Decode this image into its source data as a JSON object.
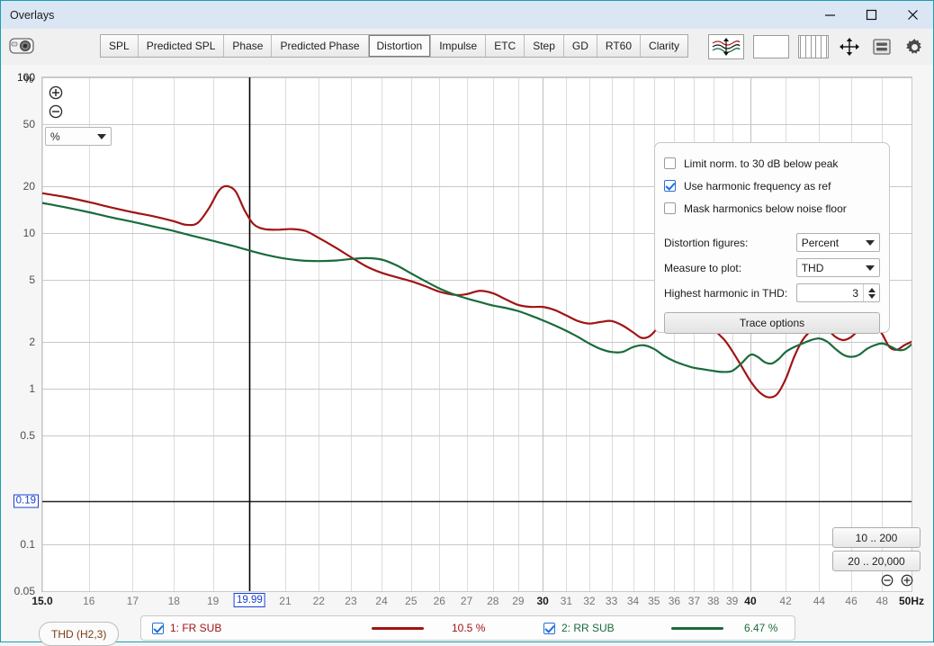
{
  "window": {
    "title": "Overlays",
    "controls": [
      {
        "name": "minimize-button",
        "glyph": "minimize"
      },
      {
        "name": "maximize-button",
        "glyph": "maximize"
      },
      {
        "name": "close-button",
        "glyph": "close"
      }
    ]
  },
  "toolbar": {
    "camera_icon": "camera-icon",
    "tabs": [
      {
        "label": "SPL",
        "active": false
      },
      {
        "label": "Predicted SPL",
        "active": false
      },
      {
        "label": "Phase",
        "active": false
      },
      {
        "label": "Predicted Phase",
        "active": false
      },
      {
        "label": "Distortion",
        "active": true
      },
      {
        "label": "Impulse",
        "active": false
      },
      {
        "label": "ETC",
        "active": false
      },
      {
        "label": "Step",
        "active": false
      },
      {
        "label": "GD",
        "active": false
      },
      {
        "label": "RT60",
        "active": false
      },
      {
        "label": "Clarity",
        "active": false
      }
    ],
    "right_icons": [
      {
        "name": "waveform-overlay-icon"
      },
      {
        "name": "blank-panel-icon"
      },
      {
        "name": "vertical-bars-icon"
      },
      {
        "name": "fit-to-window-icon"
      },
      {
        "name": "legend-toggle-icon"
      },
      {
        "name": "gear-icon"
      }
    ]
  },
  "graph_controls": {
    "zoom_in_icon": "zoom-in-icon",
    "zoom_out_icon": "zoom-out-icon",
    "unit_select_value": "%",
    "trace_pill_label": "THD (H2,3)",
    "range_buttons": [
      "10 .. 200",
      "20 .. 20,000"
    ],
    "range_zoom_out_icon": "zoom-out-icon",
    "range_zoom_in_icon": "zoom-in-icon"
  },
  "options_panel": {
    "checkboxes": [
      {
        "label": "Limit norm. to 30 dB below peak",
        "checked": false
      },
      {
        "label": "Use harmonic frequency as ref",
        "checked": true
      },
      {
        "label": "Mask harmonics below noise floor",
        "checked": false
      }
    ],
    "fields": [
      {
        "label": "Distortion figures:",
        "value": "Percent",
        "type": "combo"
      },
      {
        "label": "Measure to plot:",
        "value": "THD",
        "type": "combo"
      },
      {
        "label": "Highest harmonic in THD:",
        "value": "3",
        "type": "spinner"
      }
    ],
    "trace_options_button": "Trace options"
  },
  "legend": {
    "items": [
      {
        "label": "1: FR SUB",
        "value": "10.5 %",
        "color": "#a01414",
        "checked": true
      },
      {
        "label": "2: RR SUB",
        "value": "6.47 %",
        "color": "#1a6b3c",
        "checked": true
      }
    ]
  },
  "chart_data": {
    "type": "line",
    "title": "Distortion",
    "xlabel": "Hz",
    "ylabel": "%",
    "xscale": "log",
    "yscale": "log",
    "xlim": [
      15.0,
      50.0
    ],
    "ylim": [
      0.05,
      100
    ],
    "grid": true,
    "unit_suffix": "Hz",
    "xticks": [
      "15.0",
      "16",
      "17",
      "18",
      "19",
      "21",
      "22",
      "23",
      "24",
      "25",
      "26",
      "27",
      "28",
      "29",
      "30",
      "31",
      "32",
      "33",
      "34",
      "35",
      "36",
      "37",
      "38",
      "39",
      "40",
      "42",
      "44",
      "46",
      "48",
      "50Hz"
    ],
    "xtick_values": [
      15.0,
      16,
      17,
      18,
      19,
      21,
      22,
      23,
      24,
      25,
      26,
      27,
      28,
      29,
      30,
      31,
      32,
      33,
      34,
      35,
      36,
      37,
      38,
      39,
      40,
      42,
      44,
      46,
      48,
      50
    ],
    "xticks_bold": [
      "15.0",
      "30",
      "40",
      "50Hz"
    ],
    "yticks": [
      "100",
      "50",
      "20",
      "10",
      "5",
      "2",
      "1",
      "0.5",
      "0.1",
      "0.05"
    ],
    "ytick_values": [
      100,
      50,
      20,
      10,
      5,
      2,
      1,
      0.5,
      0.1,
      0.05
    ],
    "cursor": {
      "x_label": "19.99",
      "x_value": 19.99,
      "y_label": "0.19",
      "y_value": 0.19
    },
    "series": [
      {
        "name": "1: FR SUB",
        "color": "#a01414",
        "readout": "10.5 %",
        "points": [
          [
            15.0,
            18.0
          ],
          [
            15.5,
            17.0
          ],
          [
            16.0,
            15.8
          ],
          [
            16.5,
            14.6
          ],
          [
            17.0,
            13.6
          ],
          [
            17.5,
            12.8
          ],
          [
            18.0,
            11.9
          ],
          [
            18.3,
            11.3
          ],
          [
            18.6,
            11.6
          ],
          [
            18.9,
            14.5
          ],
          [
            19.15,
            18.6
          ],
          [
            19.35,
            20.0
          ],
          [
            19.6,
            18.6
          ],
          [
            19.85,
            14.0
          ],
          [
            20.1,
            11.4
          ],
          [
            20.4,
            10.6
          ],
          [
            20.8,
            10.5
          ],
          [
            21.2,
            10.6
          ],
          [
            21.6,
            10.3
          ],
          [
            22.0,
            9.3
          ],
          [
            22.5,
            8.1
          ],
          [
            23.0,
            7.0
          ],
          [
            23.5,
            6.1
          ],
          [
            24.0,
            5.55
          ],
          [
            24.5,
            5.2
          ],
          [
            25.0,
            4.9
          ],
          [
            25.5,
            4.55
          ],
          [
            26.0,
            4.2
          ],
          [
            26.6,
            4.0
          ],
          [
            27.0,
            4.05
          ],
          [
            27.5,
            4.25
          ],
          [
            28.0,
            4.1
          ],
          [
            28.5,
            3.75
          ],
          [
            29.0,
            3.45
          ],
          [
            29.5,
            3.35
          ],
          [
            30.0,
            3.35
          ],
          [
            30.5,
            3.2
          ],
          [
            31.0,
            2.95
          ],
          [
            31.5,
            2.72
          ],
          [
            32.0,
            2.62
          ],
          [
            32.5,
            2.68
          ],
          [
            33.0,
            2.72
          ],
          [
            33.5,
            2.55
          ],
          [
            34.0,
            2.3
          ],
          [
            34.4,
            2.12
          ],
          [
            34.8,
            2.18
          ],
          [
            35.2,
            2.5
          ],
          [
            35.6,
            3.1
          ],
          [
            36.0,
            3.6
          ],
          [
            36.4,
            3.85
          ],
          [
            36.8,
            3.8
          ],
          [
            37.3,
            3.35
          ],
          [
            37.8,
            2.75
          ],
          [
            38.2,
            2.3
          ],
          [
            38.6,
            2.05
          ],
          [
            39.0,
            1.75
          ],
          [
            39.5,
            1.4
          ],
          [
            40.0,
            1.12
          ],
          [
            40.5,
            0.95
          ],
          [
            41.0,
            0.88
          ],
          [
            41.5,
            0.92
          ],
          [
            42.0,
            1.15
          ],
          [
            42.5,
            1.6
          ],
          [
            43.0,
            2.05
          ],
          [
            43.5,
            2.35
          ],
          [
            44.0,
            2.5
          ],
          [
            44.5,
            2.4
          ],
          [
            45.0,
            2.15
          ],
          [
            45.5,
            2.05
          ],
          [
            46.0,
            2.15
          ],
          [
            46.5,
            2.4
          ],
          [
            47.0,
            2.6
          ],
          [
            47.5,
            2.6
          ],
          [
            48.0,
            2.25
          ],
          [
            48.5,
            1.85
          ],
          [
            49.0,
            1.78
          ],
          [
            49.5,
            1.9
          ],
          [
            50.0,
            2.0
          ]
        ]
      },
      {
        "name": "2: RR SUB",
        "color": "#1a6b3c",
        "readout": "6.47 %",
        "points": [
          [
            15.0,
            15.6
          ],
          [
            15.5,
            14.6
          ],
          [
            16.0,
            13.6
          ],
          [
            16.5,
            12.6
          ],
          [
            17.0,
            11.8
          ],
          [
            17.5,
            11.0
          ],
          [
            18.0,
            10.3
          ],
          [
            18.5,
            9.55
          ],
          [
            19.0,
            8.9
          ],
          [
            19.5,
            8.3
          ],
          [
            20.0,
            7.7
          ],
          [
            20.5,
            7.2
          ],
          [
            21.0,
            6.85
          ],
          [
            21.5,
            6.65
          ],
          [
            22.0,
            6.6
          ],
          [
            22.5,
            6.65
          ],
          [
            23.0,
            6.8
          ],
          [
            23.5,
            6.9
          ],
          [
            24.0,
            6.75
          ],
          [
            24.5,
            6.2
          ],
          [
            25.0,
            5.5
          ],
          [
            25.5,
            4.9
          ],
          [
            26.0,
            4.4
          ],
          [
            26.5,
            4.05
          ],
          [
            27.0,
            3.8
          ],
          [
            27.5,
            3.6
          ],
          [
            28.0,
            3.42
          ],
          [
            28.5,
            3.3
          ],
          [
            29.0,
            3.15
          ],
          [
            29.5,
            2.95
          ],
          [
            30.0,
            2.75
          ],
          [
            30.5,
            2.55
          ],
          [
            31.0,
            2.35
          ],
          [
            31.5,
            2.15
          ],
          [
            32.0,
            1.95
          ],
          [
            32.5,
            1.8
          ],
          [
            33.0,
            1.72
          ],
          [
            33.5,
            1.72
          ],
          [
            34.0,
            1.85
          ],
          [
            34.5,
            1.9
          ],
          [
            35.0,
            1.8
          ],
          [
            35.5,
            1.62
          ],
          [
            36.0,
            1.5
          ],
          [
            36.5,
            1.42
          ],
          [
            37.0,
            1.36
          ],
          [
            37.5,
            1.33
          ],
          [
            38.0,
            1.3
          ],
          [
            38.5,
            1.28
          ],
          [
            39.0,
            1.3
          ],
          [
            39.5,
            1.45
          ],
          [
            40.0,
            1.65
          ],
          [
            40.4,
            1.6
          ],
          [
            40.8,
            1.48
          ],
          [
            41.2,
            1.45
          ],
          [
            41.6,
            1.55
          ],
          [
            42.0,
            1.72
          ],
          [
            42.5,
            1.85
          ],
          [
            43.0,
            1.95
          ],
          [
            43.5,
            2.05
          ],
          [
            44.0,
            2.1
          ],
          [
            44.5,
            2.0
          ],
          [
            45.0,
            1.8
          ],
          [
            45.5,
            1.65
          ],
          [
            46.0,
            1.6
          ],
          [
            46.5,
            1.65
          ],
          [
            47.0,
            1.8
          ],
          [
            47.5,
            1.9
          ],
          [
            48.0,
            1.95
          ],
          [
            48.5,
            1.88
          ],
          [
            49.0,
            1.78
          ],
          [
            49.5,
            1.78
          ],
          [
            50.0,
            1.92
          ]
        ]
      }
    ]
  }
}
